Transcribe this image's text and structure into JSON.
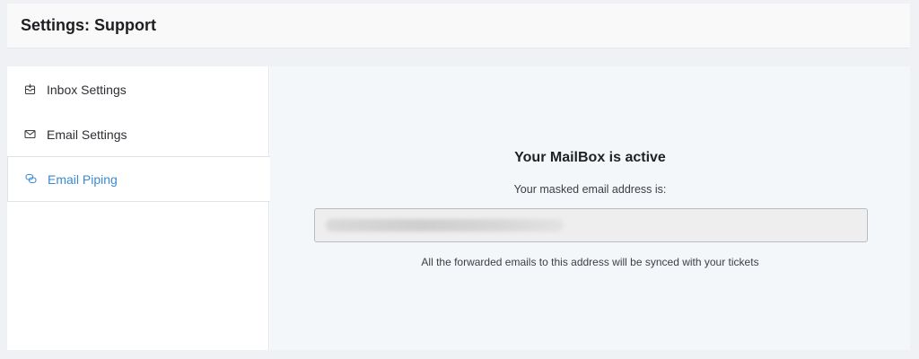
{
  "header": {
    "title": "Settings: Support"
  },
  "sidebar": {
    "items": [
      {
        "label": "Inbox Settings",
        "icon": "inbox-icon",
        "active": false
      },
      {
        "label": "Email Settings",
        "icon": "envelope-icon",
        "active": false
      },
      {
        "label": "Email Piping",
        "icon": "chat-bubbles-icon",
        "active": true
      }
    ]
  },
  "mailbox": {
    "title": "Your MailBox is active",
    "subtitle": "Your masked email address is:",
    "masked_address": "",
    "note": "All the forwarded emails to this address will be synced with your tickets"
  },
  "colors": {
    "accent": "#3a8ad1",
    "background": "#f0f1f4",
    "content_bg": "#f4f7fa",
    "text": "#1d2327"
  }
}
